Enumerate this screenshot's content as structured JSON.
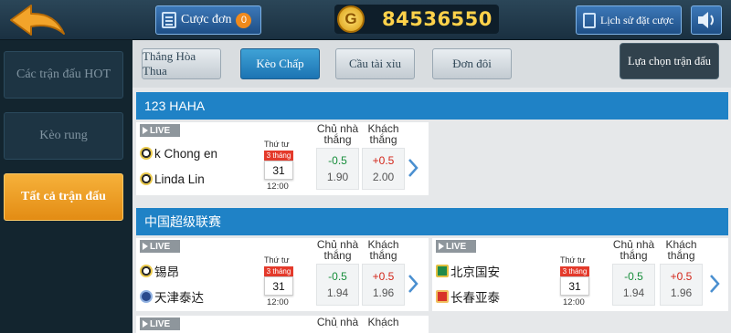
{
  "topbar": {
    "bet_label": "Cược đơn",
    "bet_count": "0",
    "coin_symbol": "G",
    "balance": "84536550",
    "history_label": "Lịch sử đặt cược"
  },
  "sidebar": {
    "items": [
      {
        "label": "Các trận đấu HOT"
      },
      {
        "label": "Kèo rung"
      },
      {
        "label": "Tất cả trận đấu"
      }
    ]
  },
  "tabs": [
    {
      "label": "Thắng Hòa Thua"
    },
    {
      "label": "Kèo Chấp"
    },
    {
      "label": "Cầu tài xỉu"
    },
    {
      "label": "Đơn đôi"
    }
  ],
  "select_label": "Lựa chọn trận đấu",
  "live_label": "LIVE",
  "home_label": "Chủ nhà thắng",
  "away_label": "Khách thắng",
  "leagues": [
    {
      "name": "123 HAHA",
      "matches": [
        {
          "home": "k Chong en",
          "away": "Linda Lin",
          "dow": "Thứ tư",
          "month": "3 tháng",
          "day": "31",
          "time": "12:00",
          "home_line": "-0.5",
          "home_price": "1.90",
          "away_line": "+0.5",
          "away_price": "2.00"
        }
      ]
    },
    {
      "name": "中国超级联赛",
      "matches": [
        {
          "home": "锡昂",
          "away": "天津泰达",
          "dow": "Thứ tư",
          "month": "3 tháng",
          "day": "31",
          "time": "12:00",
          "home_line": "-0.5",
          "home_price": "1.94",
          "away_line": "+0.5",
          "away_price": "1.96"
        },
        {
          "home": "北京国安",
          "away": "长春亚泰",
          "dow": "Thứ tư",
          "month": "3 tháng",
          "day": "31",
          "time": "12:00",
          "home_line": "-0.5",
          "home_price": "1.94",
          "away_line": "+0.5",
          "away_price": "1.96"
        }
      ]
    }
  ],
  "colors": {
    "accent_blue": "#1f82c6",
    "active_orange": "#e9951c",
    "balance_gold": "#ffd24a",
    "negative_line": "#168d3a",
    "positive_line": "#d3261a"
  }
}
